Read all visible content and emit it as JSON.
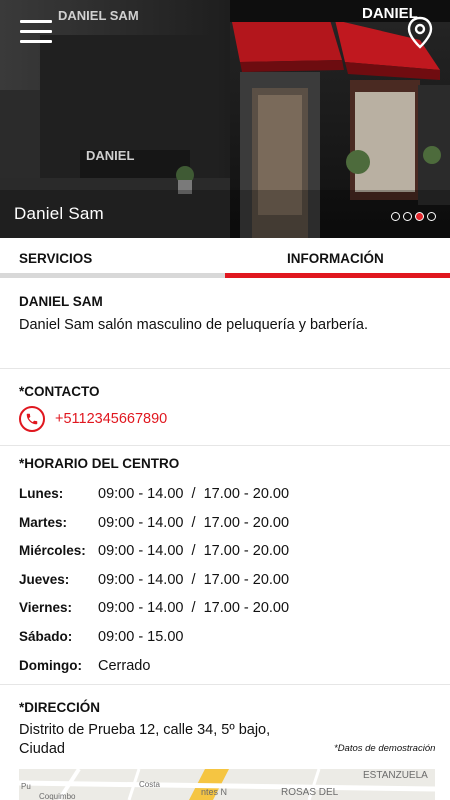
{
  "hero": {
    "title": "Daniel Sam",
    "slides": [
      {
        "active": false
      },
      {
        "active": false
      },
      {
        "active": true
      },
      {
        "active": false
      }
    ],
    "storefront_sign_left": "DANIEL",
    "storefront_sign_top": "DANIEL SAM",
    "storefront_sign_right": "DANIEL"
  },
  "tabs": [
    {
      "label": "SERVICIOS",
      "active": false
    },
    {
      "label": "INFORMACIÓN",
      "active": true
    }
  ],
  "about": {
    "title": "DANIEL SAM",
    "description": "Daniel Sam salón masculino de peluquería y barbería."
  },
  "contact": {
    "title": "*CONTACTO",
    "phone": "+5112345667890"
  },
  "schedule": {
    "title": "*HORARIO DEL CENTRO",
    "rows": [
      {
        "day": "Lunes:",
        "hours": "09:00 - 14.00  /  17.00 - 20.00"
      },
      {
        "day": "Martes:",
        "hours": "09:00 - 14.00  /  17.00 - 20.00"
      },
      {
        "day": "Miércoles:",
        "hours": "09:00 - 14.00  /  17.00 - 20.00"
      },
      {
        "day": "Jueves:",
        "hours": "09:00 - 14.00  /  17.00 - 20.00"
      },
      {
        "day": "Viernes:",
        "hours": "09:00 - 14.00  /  17.00 - 20.00"
      },
      {
        "day": "Sábado:",
        "hours": "09:00 - 15.00"
      },
      {
        "day": "Domingo:",
        "hours": "Cerrado"
      }
    ]
  },
  "address": {
    "title": "*DIRECCIÓN",
    "line1": "Distrito de Prueba 12, calle 34, 5º bajo,",
    "line2": "Ciudad",
    "note": "*Datos de demostración"
  },
  "map": {
    "labels": [
      "ESTANZUELA",
      "ROSAS DEL",
      "Pu",
      "Coquimbo",
      "Costa",
      "ntes N"
    ]
  },
  "colors": {
    "accent": "#e0171f",
    "inactive_tab": "#d8d8d8",
    "divider": "#e6e6e6"
  }
}
